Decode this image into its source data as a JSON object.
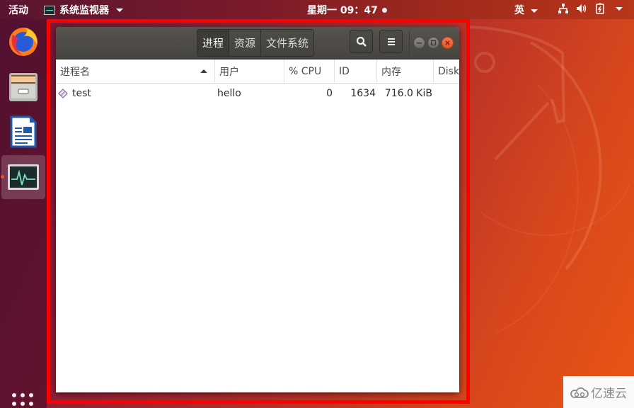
{
  "topbar": {
    "activities": "活动",
    "app_menu_label": "系统监视器",
    "clock": "星期一 09：47",
    "input_method": "英",
    "tray_icons": [
      "network-icon",
      "volume-icon",
      "battery-icon"
    ]
  },
  "dock": {
    "items": [
      {
        "name": "firefox",
        "icon": "firefox-icon",
        "active": false
      },
      {
        "name": "files",
        "icon": "file-cabinet-icon",
        "active": false
      },
      {
        "name": "libreoffice-writer",
        "icon": "writer-document-icon",
        "active": false
      },
      {
        "name": "system-monitor",
        "icon": "system-monitor-icon",
        "active": true
      }
    ],
    "show_apps_icon": "apps-grid-icon"
  },
  "window": {
    "tabs": [
      {
        "label": "进程",
        "active": true
      },
      {
        "label": "资源",
        "active": false
      },
      {
        "label": "文件系统",
        "active": false
      }
    ],
    "search_icon": "search-icon",
    "menu_icon": "hamburger-menu-icon",
    "controls": [
      "minimize",
      "maximize",
      "close"
    ],
    "table": {
      "columns": [
        "进程名",
        "用户",
        "% CPU",
        "ID",
        "内存",
        "Disk"
      ],
      "sort_column": "进程名",
      "sort_direction": "ascending",
      "rows": [
        {
          "icon": "process-icon",
          "name": "test",
          "user": "hello",
          "cpu": "0",
          "id": "1634",
          "memory": "716.0 KiB",
          "disk": ""
        }
      ]
    }
  },
  "watermark": {
    "text": "亿速云"
  },
  "colors": {
    "highlight_border": "#ff0000",
    "ubuntu_orange": "#e95420",
    "headerbar": "#4d4b46"
  }
}
